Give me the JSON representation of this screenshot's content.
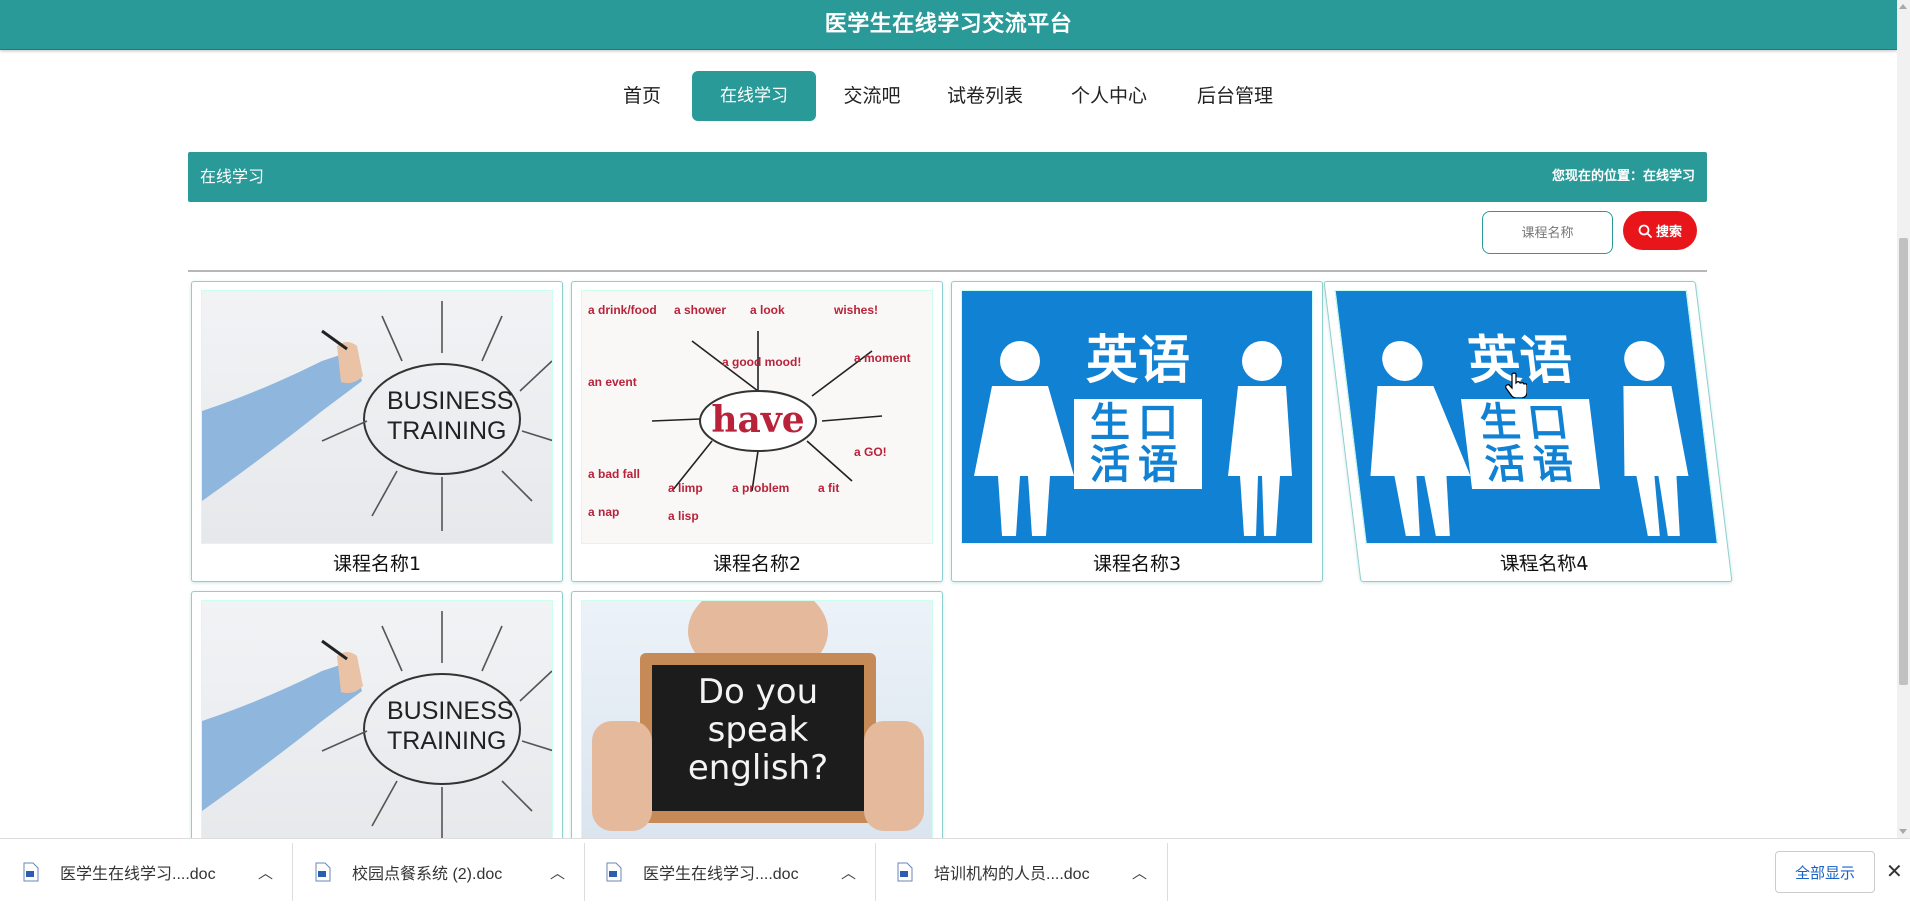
{
  "header": {
    "title": "医学生在线学习交流平台"
  },
  "nav": {
    "items": [
      {
        "label": "首页",
        "active": false
      },
      {
        "label": "在线学习",
        "active": true
      },
      {
        "label": "交流吧",
        "active": false
      },
      {
        "label": "试卷列表",
        "active": false
      },
      {
        "label": "个人中心",
        "active": false
      },
      {
        "label": "后台管理",
        "active": false
      }
    ]
  },
  "section": {
    "title": "在线学习",
    "location": "您现在的位置：在线学习"
  },
  "search": {
    "placeholder": "课程名称",
    "button_label": "搜索"
  },
  "courses": [
    {
      "name": "课程名称1",
      "image": "business-training"
    },
    {
      "name": "课程名称2",
      "image": "have-word-map"
    },
    {
      "name": "课程名称3",
      "image": "english-oral"
    },
    {
      "name": "课程名称4",
      "image": "english-oral"
    },
    {
      "name": "",
      "image": "business-training"
    },
    {
      "name": "",
      "image": "do-you-speak-english"
    }
  ],
  "images": {
    "business_training": {
      "line1": "BUSINESS",
      "line2": "TRAINING"
    },
    "have_word_map": {
      "center": "have",
      "labels": [
        "a drink/food",
        "a shower",
        "a look",
        "wishes!",
        "a good mood!",
        "a moment",
        "an event",
        "a bad fall",
        "a limp",
        "a problem",
        "a fit",
        "a GO!",
        "a nap",
        "a lisp"
      ]
    },
    "english_oral": {
      "top": "英语",
      "mid": "生口",
      "bot": "活语"
    },
    "speak_english": {
      "line1": "Do you",
      "line2": "speak",
      "line3": "english?"
    }
  },
  "downloads": {
    "items": [
      {
        "name": "医学生在线学习....doc"
      },
      {
        "name": "校园点餐系统 (2).doc"
      },
      {
        "name": "医学生在线学习....doc"
      },
      {
        "name": "培训机构的人员....doc"
      }
    ],
    "show_all": "全部显示",
    "close_icon": "close-icon"
  },
  "colors": {
    "primary": "#2a9a99",
    "search_button": "#e8151a",
    "oral_blue": "#1181d3"
  }
}
